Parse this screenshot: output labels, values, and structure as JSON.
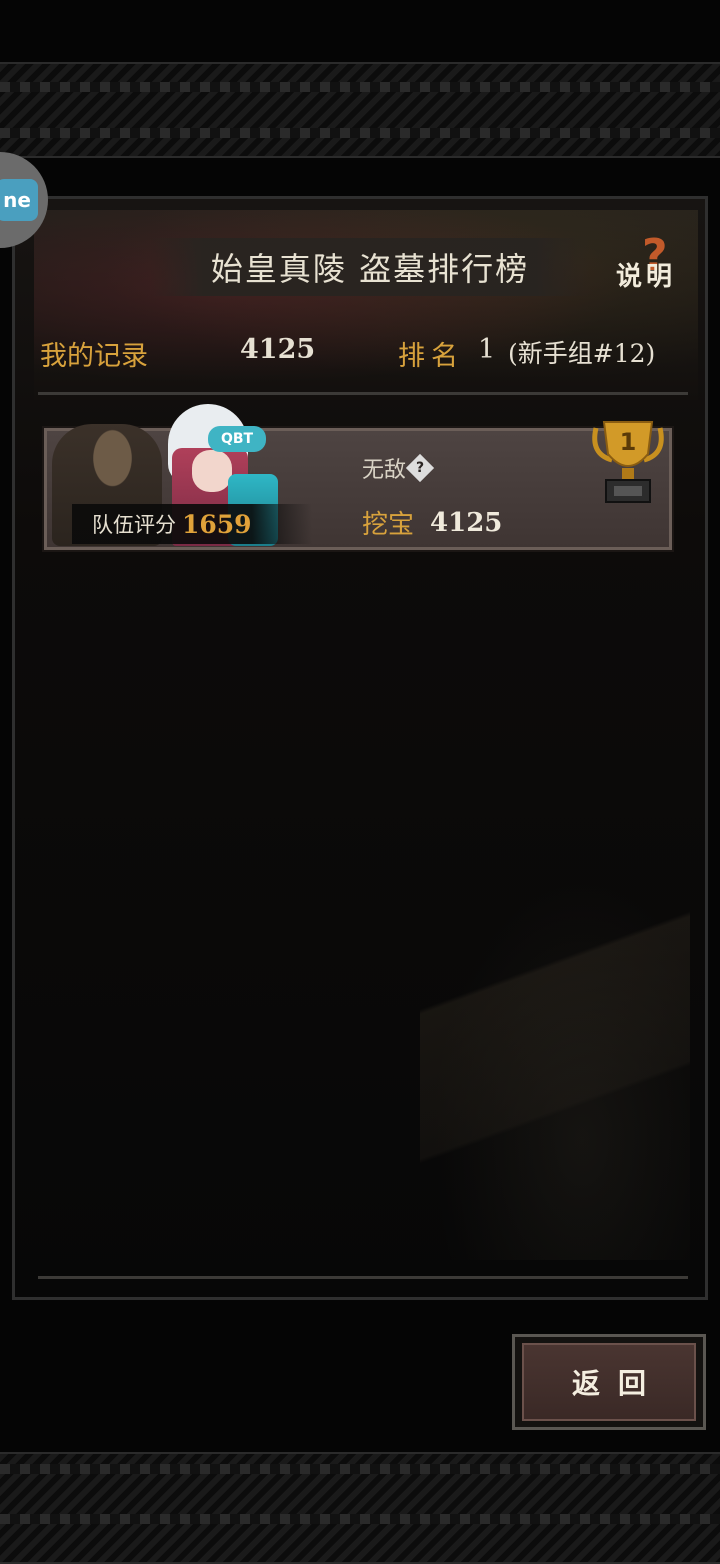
{
  "title": "始皇真陵 盗墓排行榜",
  "help": {
    "label": "说明",
    "mark": "?"
  },
  "side_badge": {
    "text": "ne"
  },
  "my_record": {
    "label": "我的记录",
    "value": "4125",
    "rank_label": "排名",
    "rank_value": "1",
    "group": "(新手组#12)"
  },
  "entries": [
    {
      "rank": "1",
      "team_score_label": "队伍评分",
      "team_score": "1659",
      "status": "无敌",
      "status_help": "?",
      "cap_logo": "QBT",
      "treasure_label": "挖宝",
      "treasure_value": "4125"
    }
  ],
  "return_button": {
    "label": "返回"
  },
  "colors": {
    "gold": "#d8a23c",
    "card": "#4e4442",
    "trophy": "#d29a28"
  }
}
